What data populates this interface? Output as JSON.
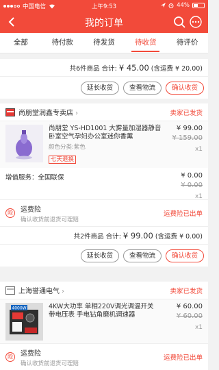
{
  "status_bar": {
    "carrier": "中国电信",
    "time": "上午9:53",
    "battery": "44%"
  },
  "nav": {
    "title": "我的订单"
  },
  "tabs": [
    "全部",
    "待付款",
    "待发货",
    "待收货",
    "待评价"
  ],
  "active_tab": 3,
  "order0": {
    "summary_prefix": "共6件商品 合计: ",
    "summary_amount": "¥ 45.00",
    "summary_suffix": " (含运费 ¥ 20.00)",
    "btn_extend": "延长收货",
    "btn_logistics": "查看物流",
    "btn_confirm": "确认收货"
  },
  "order1": {
    "store": "尚朋堂润鑫专卖店",
    "status": "卖家已发货",
    "product": {
      "title": "尚朋堂 YS-HD1001 大雾量加湿器静音卧室空气孕妇办公室迷你香薰",
      "attr": "颜色分类:紫色",
      "tag": "七天退换",
      "price": "¥ 99.00",
      "original_price": "¥ 159.00",
      "qty": "x1"
    },
    "addon": {
      "label": "增值服务：全国联保",
      "price": "¥ 0.00",
      "original_price": "¥ 0.00",
      "qty": "x1"
    },
    "insurance": {
      "title": "运费险",
      "subtitle": "确认收货前退货可理赔",
      "status": "运费险已出单"
    },
    "summary_prefix": "共2件商品 合计: ",
    "summary_amount": "¥ 99.00",
    "summary_suffix": " (含运费 ¥ 0.00)",
    "btn_extend": "延长收货",
    "btn_logistics": "查看物流",
    "btn_confirm": "确认收货"
  },
  "order2": {
    "store": "上海誉通电气",
    "status": "卖家已发货",
    "product": {
      "title": "4KW大功率 单相220V调光调温开关 带电压表 手电钻角磨机调速器",
      "price": "¥ 60.00",
      "original_price": "¥ 60.00",
      "qty": "x1",
      "image_text": "4000W"
    },
    "insurance": {
      "title": "运费险",
      "subtitle": "确认收货前退货可理赔",
      "status": "运费险已出单"
    }
  },
  "colors": {
    "accent": "#f24a3a"
  }
}
